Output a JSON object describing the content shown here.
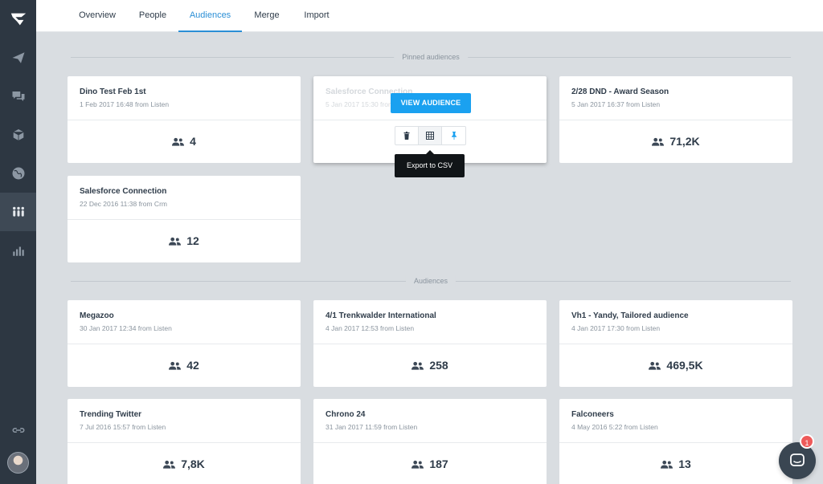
{
  "nav": {
    "tabs": [
      {
        "label": "Overview"
      },
      {
        "label": "People"
      },
      {
        "label": "Audiences"
      },
      {
        "label": "Merge"
      },
      {
        "label": "Import"
      }
    ],
    "active": "Audiences"
  },
  "sidebar": {
    "icons": [
      "logo-icon",
      "send-icon",
      "chat-icon",
      "box-icon",
      "globe-icon",
      "people-icon",
      "bar-chart-icon",
      "link-icon"
    ],
    "active": "people-icon"
  },
  "sections": {
    "pinned_label": "Pinned audiences",
    "audiences_label": "Audiences"
  },
  "pinned": [
    {
      "title": "Dino Test Feb 1st",
      "sub": "1 Feb 2017 16:48 from Listen",
      "count": "4"
    },
    {
      "title": "Salesforce Connection",
      "sub": "5 Jan 2017 15:30 from Crm",
      "count": ""
    },
    {
      "title": "2/28 DND - Award Season",
      "sub": "5 Jan 2017 16:37 from Listen",
      "count": "71,2K"
    },
    {
      "title": "Salesforce Connection",
      "sub": "22 Dec 2016 11:38 from Crm",
      "count": "12"
    }
  ],
  "hover": {
    "view_label": "VIEW AUDIENCE",
    "tooltip": "Export to CSV"
  },
  "audiences": [
    {
      "title": "Megazoo",
      "sub": "30 Jan 2017 12:34 from Listen",
      "count": "42"
    },
    {
      "title": "4/1 Trenkwalder International",
      "sub": "4 Jan 2017 12:53 from Listen",
      "count": "258"
    },
    {
      "title": "Vh1 - Yandy, Tailored audience",
      "sub": "4 Jan 2017 17:30 from Listen",
      "count": "469,5K"
    },
    {
      "title": "Trending Twitter",
      "sub": "7 Jul 2016 15:57 from Listen",
      "count": "7,8K"
    },
    {
      "title": "Chrono 24",
      "sub": "31 Jan 2017 11:59 from Listen",
      "count": "187"
    },
    {
      "title": "Falconeers",
      "sub": "4 May 2016 5:22 from Listen",
      "count": "13"
    }
  ],
  "chat": {
    "badge": "1"
  },
  "colors": {
    "accent": "#2b8fd6",
    "button": "#1aa1f0",
    "sidebar": "#2d3742",
    "background": "#d9dde1",
    "badge": "#ee5a5a"
  }
}
